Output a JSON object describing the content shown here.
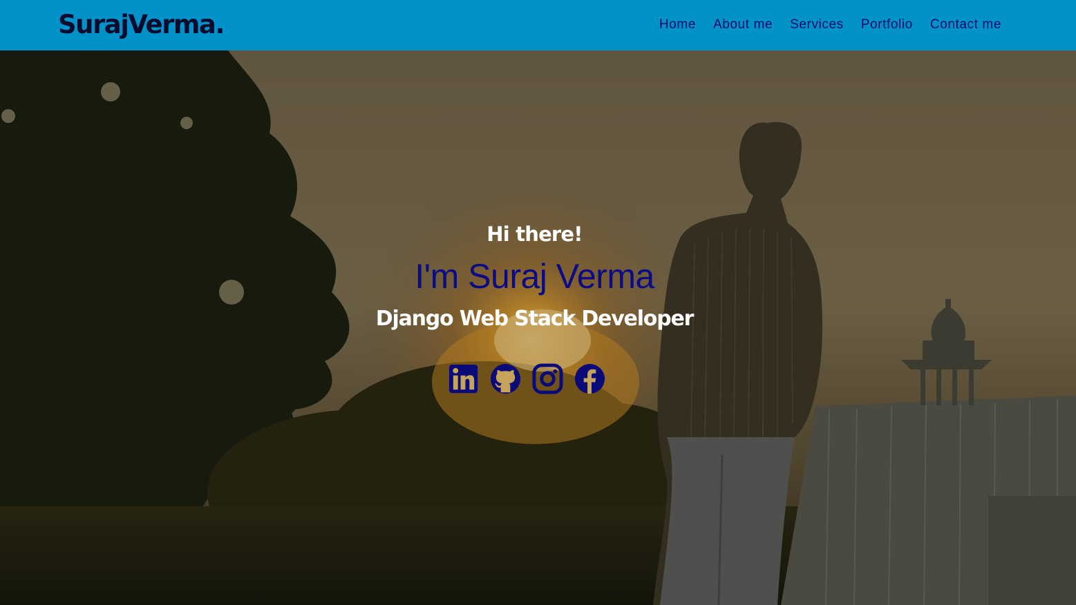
{
  "brand": {
    "name": "SurajVerma",
    "dot": "."
  },
  "nav": {
    "items": [
      {
        "label": "Home"
      },
      {
        "label": "About me"
      },
      {
        "label": "Services"
      },
      {
        "label": "Portfolio"
      },
      {
        "label": "Contact me"
      }
    ]
  },
  "hero": {
    "greeting": "Hi there!",
    "name": "I'm Suraj Verma",
    "role": "Django Web Stack Developer",
    "socials": [
      {
        "icon": "linkedin-icon"
      },
      {
        "icon": "github-icon"
      },
      {
        "icon": "instagram-icon"
      },
      {
        "icon": "facebook-icon"
      }
    ]
  },
  "colors": {
    "header_bg": "#0092c8",
    "brand_text": "#0b0b2e",
    "nav_text": "#0a0a6e",
    "accent_name": "#0b0b85",
    "social_icon": "#0a0a78"
  }
}
